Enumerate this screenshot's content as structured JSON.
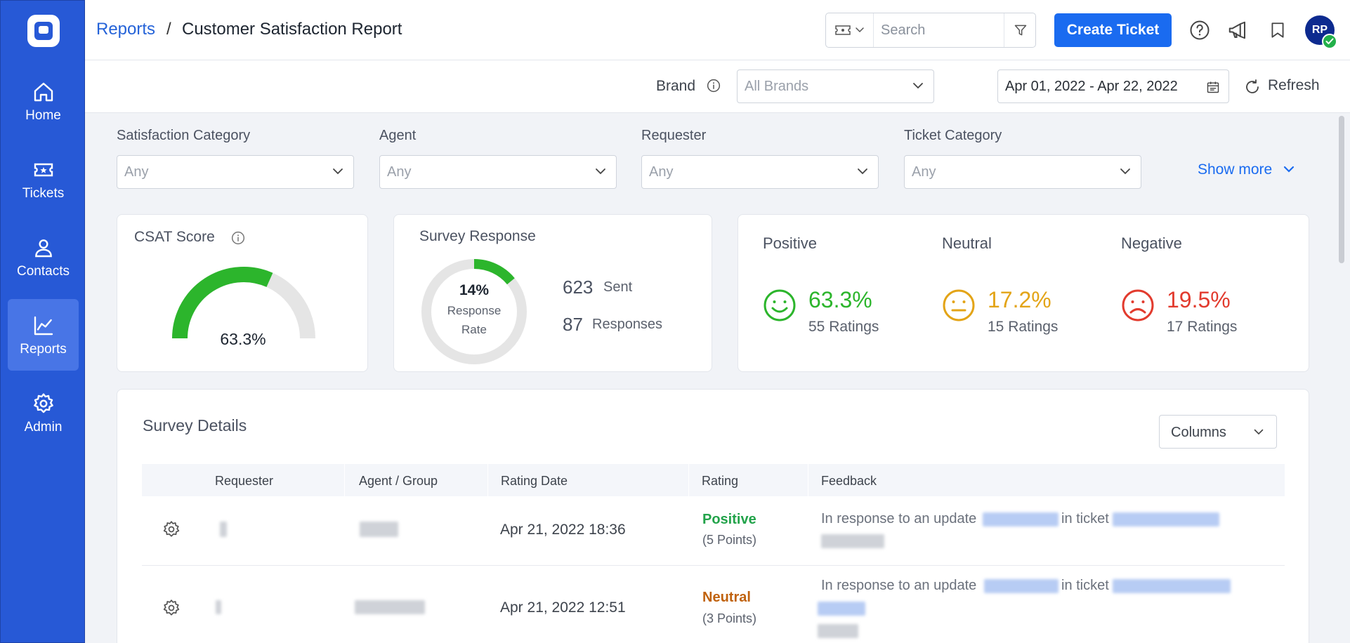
{
  "sidebar": {
    "items": [
      {
        "label": "Home",
        "icon": "home-icon"
      },
      {
        "label": "Tickets",
        "icon": "ticket-icon"
      },
      {
        "label": "Contacts",
        "icon": "user-icon"
      },
      {
        "label": "Reports",
        "icon": "chart-icon",
        "active": true
      },
      {
        "label": "Admin",
        "icon": "gear-icon"
      }
    ]
  },
  "header": {
    "breadcrumb_link": "Reports",
    "breadcrumb_sep": "/",
    "breadcrumb_current": "Customer Satisfaction Report",
    "search_placeholder": "Search",
    "create_button": "Create Ticket",
    "avatar_initials": "RP"
  },
  "toolbar": {
    "brand_label": "Brand",
    "brand_placeholder": "All Brands",
    "date_range": "Apr 01, 2022 - Apr 22, 2022",
    "refresh_label": "Refresh"
  },
  "filters": {
    "items": [
      {
        "label": "Satisfaction Category",
        "value": "Any"
      },
      {
        "label": "Agent",
        "value": "Any"
      },
      {
        "label": "Requester",
        "value": "Any"
      },
      {
        "label": "Ticket Category",
        "value": "Any"
      }
    ],
    "show_more": "Show more"
  },
  "csat": {
    "title": "CSAT Score",
    "score_text": "63.3%",
    "score_fraction": 0.633,
    "color": "#2cb52c"
  },
  "survey_response": {
    "title": "Survey Response",
    "rate_text": "14%",
    "rate_fraction": 0.14,
    "rate_line1": "Response",
    "rate_line2": "Rate",
    "sent_count": "623",
    "sent_label": "Sent",
    "responses_count": "87",
    "responses_label": "Responses"
  },
  "sentiment": {
    "positive": {
      "label": "Positive",
      "percent": "63.3%",
      "ratings": "55 Ratings",
      "color": "#2cb52c"
    },
    "neutral": {
      "label": "Neutral",
      "percent": "17.2%",
      "ratings": "15 Ratings",
      "color": "#e3a417"
    },
    "negative": {
      "label": "Negative",
      "percent": "19.5%",
      "ratings": "17 Ratings",
      "color": "#e23b2e"
    }
  },
  "survey_details": {
    "title": "Survey Details",
    "columns_button": "Columns",
    "headers": [
      "Requester",
      "Agent / Group",
      "Rating Date",
      "Rating",
      "Feedback"
    ],
    "rows": [
      {
        "date": "Apr 21, 2022 18:36",
        "rating": "Positive",
        "points": "(5 Points)",
        "rating_color": "#22a34a",
        "feedback_a": "In response to an update",
        "feedback_b": "in ticket"
      },
      {
        "date": "Apr 21, 2022 12:51",
        "rating": "Neutral",
        "points": "(3 Points)",
        "rating_color": "#c0620e",
        "feedback_a": "In response to an update",
        "feedback_b": "in ticket"
      }
    ]
  }
}
